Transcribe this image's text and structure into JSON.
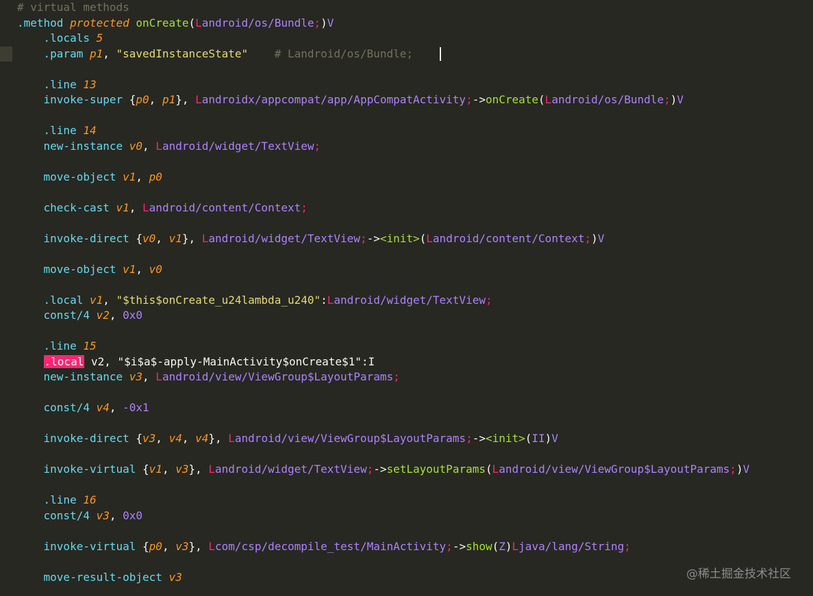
{
  "code": {
    "lines": [
      [
        [
          "tok-comment",
          "# virtual methods"
        ]
      ],
      [
        [
          "tok-dir",
          ".method "
        ],
        [
          "tok-ital",
          "protected "
        ],
        [
          "tok-grn",
          "onCreate"
        ],
        [
          "tok-punct",
          "("
        ],
        [
          "tok-L",
          "L"
        ],
        [
          "tok-type",
          "android/os/Bundle"
        ],
        [
          "tok-L",
          ";"
        ],
        [
          "tok-punct",
          ")"
        ],
        [
          "tok-type",
          "V"
        ]
      ],
      [
        [
          "tok-plain",
          "    "
        ],
        [
          "tok-dir",
          ".locals "
        ],
        [
          "tok-num",
          "5"
        ]
      ],
      [
        [
          "tok-plain",
          "    "
        ],
        [
          "tok-dir",
          ".param "
        ],
        [
          "tok-reg",
          "p1"
        ],
        [
          "tok-punct",
          ", "
        ],
        [
          "tok-str",
          "\"savedInstanceState\""
        ],
        [
          "tok-plain",
          "    "
        ],
        [
          "tok-comment",
          "# Landroid/os/Bundle;"
        ]
      ],
      [],
      [
        [
          "tok-plain",
          "    "
        ],
        [
          "tok-dir",
          ".line "
        ],
        [
          "tok-num",
          "13"
        ]
      ],
      [
        [
          "tok-plain",
          "    "
        ],
        [
          "tok-dir",
          "invoke-super "
        ],
        [
          "tok-punct",
          "{"
        ],
        [
          "tok-reg",
          "p0"
        ],
        [
          "tok-punct",
          ", "
        ],
        [
          "tok-reg",
          "p1"
        ],
        [
          "tok-punct",
          "}, "
        ],
        [
          "tok-L",
          "L"
        ],
        [
          "tok-type",
          "androidx/appcompat/app/AppCompatActivity"
        ],
        [
          "tok-L",
          ";"
        ],
        [
          "tok-punct",
          "->"
        ],
        [
          "tok-grn",
          "onCreate"
        ],
        [
          "tok-punct",
          "("
        ],
        [
          "tok-L",
          "L"
        ],
        [
          "tok-type",
          "android/os/Bundle"
        ],
        [
          "tok-L",
          ";"
        ],
        [
          "tok-punct",
          ")"
        ],
        [
          "tok-type",
          "V"
        ]
      ],
      [],
      [
        [
          "tok-plain",
          "    "
        ],
        [
          "tok-dir",
          ".line "
        ],
        [
          "tok-num",
          "14"
        ]
      ],
      [
        [
          "tok-plain",
          "    "
        ],
        [
          "tok-dir",
          "new-instance "
        ],
        [
          "tok-reg",
          "v0"
        ],
        [
          "tok-punct",
          ", "
        ],
        [
          "tok-L",
          "L"
        ],
        [
          "tok-type",
          "android/widget/TextView"
        ],
        [
          "tok-L",
          ";"
        ]
      ],
      [],
      [
        [
          "tok-plain",
          "    "
        ],
        [
          "tok-dir",
          "move-object "
        ],
        [
          "tok-reg",
          "v1"
        ],
        [
          "tok-punct",
          ", "
        ],
        [
          "tok-reg",
          "p0"
        ]
      ],
      [],
      [
        [
          "tok-plain",
          "    "
        ],
        [
          "tok-dir",
          "check-cast "
        ],
        [
          "tok-reg",
          "v1"
        ],
        [
          "tok-punct",
          ", "
        ],
        [
          "tok-L",
          "L"
        ],
        [
          "tok-type",
          "android/content/Context"
        ],
        [
          "tok-L",
          ";"
        ]
      ],
      [],
      [
        [
          "tok-plain",
          "    "
        ],
        [
          "tok-dir",
          "invoke-direct "
        ],
        [
          "tok-punct",
          "{"
        ],
        [
          "tok-reg",
          "v0"
        ],
        [
          "tok-punct",
          ", "
        ],
        [
          "tok-reg",
          "v1"
        ],
        [
          "tok-punct",
          "}, "
        ],
        [
          "tok-L",
          "L"
        ],
        [
          "tok-type",
          "android/widget/TextView"
        ],
        [
          "tok-L",
          ";"
        ],
        [
          "tok-punct",
          "->"
        ],
        [
          "tok-grn",
          "<init>"
        ],
        [
          "tok-punct",
          "("
        ],
        [
          "tok-L",
          "L"
        ],
        [
          "tok-type",
          "android/content/Context"
        ],
        [
          "tok-L",
          ";"
        ],
        [
          "tok-punct",
          ")"
        ],
        [
          "tok-type",
          "V"
        ]
      ],
      [],
      [
        [
          "tok-plain",
          "    "
        ],
        [
          "tok-dir",
          "move-object "
        ],
        [
          "tok-reg",
          "v1"
        ],
        [
          "tok-punct",
          ", "
        ],
        [
          "tok-reg",
          "v0"
        ]
      ],
      [],
      [
        [
          "tok-plain",
          "    "
        ],
        [
          "tok-dir",
          ".local "
        ],
        [
          "tok-reg",
          "v1"
        ],
        [
          "tok-punct",
          ", "
        ],
        [
          "tok-str",
          "\"$this$onCreate_u24lambda_u240\""
        ],
        [
          "tok-punct",
          ":"
        ],
        [
          "tok-L",
          "L"
        ],
        [
          "tok-type",
          "android/widget/TextView"
        ],
        [
          "tok-L",
          ";"
        ]
      ],
      [
        [
          "tok-plain",
          "    "
        ],
        [
          "tok-dir",
          "const/4 "
        ],
        [
          "tok-reg",
          "v2"
        ],
        [
          "tok-punct",
          ", "
        ],
        [
          "tok-type",
          "0x0"
        ]
      ],
      [],
      [
        [
          "tok-plain",
          "    "
        ],
        [
          "tok-dir",
          ".line "
        ],
        [
          "tok-num",
          "15"
        ]
      ],
      [
        [
          "tok-plain",
          "    "
        ],
        [
          "tok-sel",
          ".local"
        ],
        [
          "tok-plain",
          " v2, \"$i$a$-apply-MainActivity$onCreate$1\":I"
        ]
      ],
      [
        [
          "tok-plain",
          "    "
        ],
        [
          "tok-dir",
          "new-instance "
        ],
        [
          "tok-reg",
          "v3"
        ],
        [
          "tok-punct",
          ", "
        ],
        [
          "tok-L",
          "L"
        ],
        [
          "tok-type",
          "android/view/ViewGroup$LayoutParams"
        ],
        [
          "tok-L",
          ";"
        ]
      ],
      [],
      [
        [
          "tok-plain",
          "    "
        ],
        [
          "tok-dir",
          "const/4 "
        ],
        [
          "tok-reg",
          "v4"
        ],
        [
          "tok-punct",
          ", "
        ],
        [
          "tok-type",
          "-0x1"
        ]
      ],
      [],
      [
        [
          "tok-plain",
          "    "
        ],
        [
          "tok-dir",
          "invoke-direct "
        ],
        [
          "tok-punct",
          "{"
        ],
        [
          "tok-reg",
          "v3"
        ],
        [
          "tok-punct",
          ", "
        ],
        [
          "tok-reg",
          "v4"
        ],
        [
          "tok-punct",
          ", "
        ],
        [
          "tok-reg",
          "v4"
        ],
        [
          "tok-punct",
          "}, "
        ],
        [
          "tok-L",
          "L"
        ],
        [
          "tok-type",
          "android/view/ViewGroup$LayoutParams"
        ],
        [
          "tok-L",
          ";"
        ],
        [
          "tok-punct",
          "->"
        ],
        [
          "tok-grn",
          "<init>"
        ],
        [
          "tok-punct",
          "("
        ],
        [
          "tok-type",
          "II"
        ],
        [
          "tok-punct",
          ")"
        ],
        [
          "tok-type",
          "V"
        ]
      ],
      [],
      [
        [
          "tok-plain",
          "    "
        ],
        [
          "tok-dir",
          "invoke-virtual "
        ],
        [
          "tok-punct",
          "{"
        ],
        [
          "tok-reg",
          "v1"
        ],
        [
          "tok-punct",
          ", "
        ],
        [
          "tok-reg",
          "v3"
        ],
        [
          "tok-punct",
          "}, "
        ],
        [
          "tok-L",
          "L"
        ],
        [
          "tok-type",
          "android/widget/TextView"
        ],
        [
          "tok-L",
          ";"
        ],
        [
          "tok-punct",
          "->"
        ],
        [
          "tok-grn",
          "setLayoutParams"
        ],
        [
          "tok-punct",
          "("
        ],
        [
          "tok-L",
          "L"
        ],
        [
          "tok-type",
          "android/view/ViewGroup$LayoutParams"
        ],
        [
          "tok-L",
          ";"
        ],
        [
          "tok-punct",
          ")"
        ],
        [
          "tok-type",
          "V"
        ]
      ],
      [],
      [
        [
          "tok-plain",
          "    "
        ],
        [
          "tok-dir",
          ".line "
        ],
        [
          "tok-num",
          "16"
        ]
      ],
      [
        [
          "tok-plain",
          "    "
        ],
        [
          "tok-dir",
          "const/4 "
        ],
        [
          "tok-reg",
          "v3"
        ],
        [
          "tok-punct",
          ", "
        ],
        [
          "tok-type",
          "0x0"
        ]
      ],
      [],
      [
        [
          "tok-plain",
          "    "
        ],
        [
          "tok-dir",
          "invoke-virtual "
        ],
        [
          "tok-punct",
          "{"
        ],
        [
          "tok-reg",
          "p0"
        ],
        [
          "tok-punct",
          ", "
        ],
        [
          "tok-reg",
          "v3"
        ],
        [
          "tok-punct",
          "}, "
        ],
        [
          "tok-L",
          "L"
        ],
        [
          "tok-type",
          "com/csp/decompile_test/MainActivity"
        ],
        [
          "tok-L",
          ";"
        ],
        [
          "tok-punct",
          "->"
        ],
        [
          "tok-grn",
          "show"
        ],
        [
          "tok-punct",
          "("
        ],
        [
          "tok-type",
          "Z"
        ],
        [
          "tok-punct",
          ")"
        ],
        [
          "tok-L",
          "L"
        ],
        [
          "tok-type",
          "java/lang/String"
        ],
        [
          "tok-L",
          ";"
        ]
      ],
      [],
      [
        [
          "tok-plain",
          "    "
        ],
        [
          "tok-dir",
          "move-result-object "
        ],
        [
          "tok-reg",
          "v3"
        ]
      ]
    ]
  },
  "watermark": "@稀土掘金技术社区",
  "colors": {
    "background": "#272822",
    "directive": "#66d9ef",
    "method_name": "#a6e22e",
    "register": "#fd971f",
    "string": "#e6db74",
    "comment": "#75715e",
    "type": "#ae81ff",
    "class_prefix": "#f92672",
    "selection": "#f92672"
  }
}
